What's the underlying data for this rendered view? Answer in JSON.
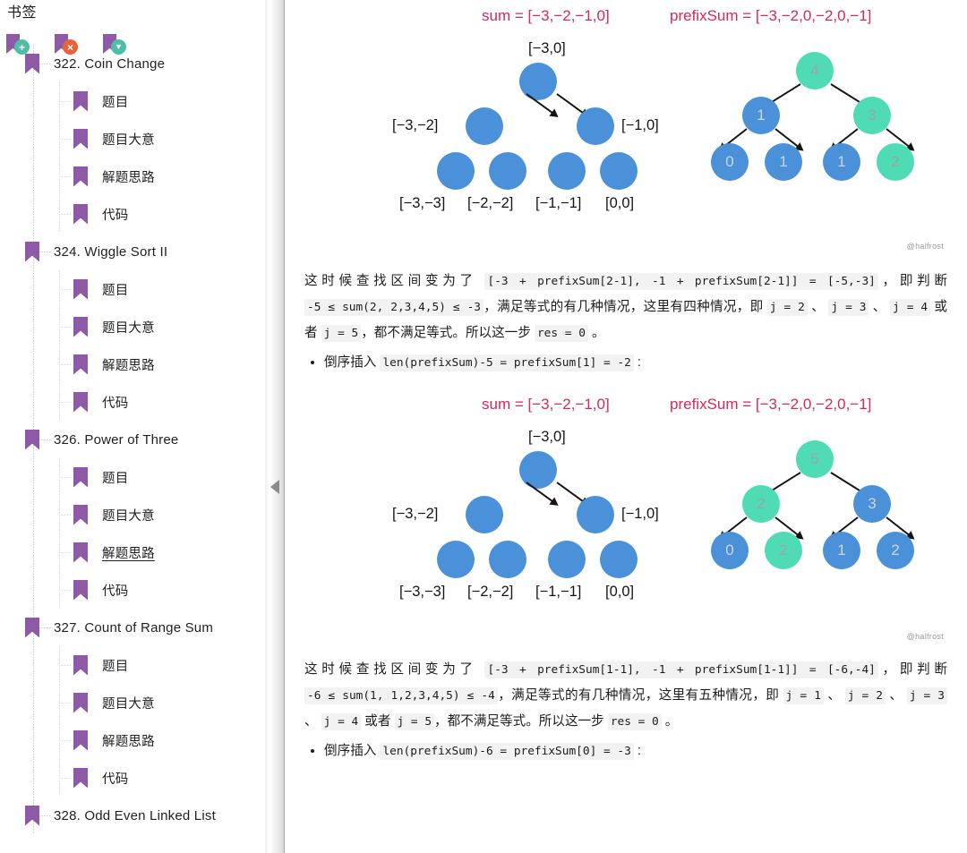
{
  "sidebar": {
    "title": "书签",
    "toolbar": [
      {
        "name": "add-bookmark-icon",
        "glyph": "+"
      },
      {
        "name": "delete-bookmark-icon",
        "glyph": "×"
      },
      {
        "name": "bookmark-menu-icon",
        "glyph": "▼"
      }
    ],
    "tree": [
      {
        "label": "322. Coin Change",
        "type": "group",
        "expanded": true
      },
      {
        "label": "题目",
        "type": "child"
      },
      {
        "label": "题目大意",
        "type": "child"
      },
      {
        "label": "解题思路",
        "type": "child"
      },
      {
        "label": "代码",
        "type": "child"
      },
      {
        "label": "324. Wiggle Sort II",
        "type": "group",
        "expanded": true
      },
      {
        "label": "题目",
        "type": "child"
      },
      {
        "label": "题目大意",
        "type": "child"
      },
      {
        "label": "解题思路",
        "type": "child"
      },
      {
        "label": "代码",
        "type": "child"
      },
      {
        "label": "326. Power of Three",
        "type": "group",
        "expanded": true
      },
      {
        "label": "题目",
        "type": "child"
      },
      {
        "label": "题目大意",
        "type": "child"
      },
      {
        "label": "解题思路",
        "type": "child",
        "active": true
      },
      {
        "label": "代码",
        "type": "child"
      },
      {
        "label": "327. Count of Range Sum",
        "type": "group",
        "expanded": true
      },
      {
        "label": "题目",
        "type": "child"
      },
      {
        "label": "题目大意",
        "type": "child"
      },
      {
        "label": "解题思路",
        "type": "child"
      },
      {
        "label": "代码",
        "type": "child"
      },
      {
        "label": "328. Odd Even Linked List",
        "type": "group",
        "expanded": true
      }
    ]
  },
  "splitter": {
    "collapse_icon": "collapse-left-arrow"
  },
  "colors": {
    "bookmark_purple": "#8e5aa8",
    "badge_add": "#4cbfa6",
    "badge_delete": "#e8633a",
    "title_red": "#d6285a",
    "node_blue": "#4a91da",
    "node_green": "#4fdcb4"
  },
  "content": {
    "figures": [
      {
        "watermark": "@halfrost",
        "left": {
          "title": "sum = [−3,−2,−1,0]",
          "root_label": "[−3,0]",
          "mid_labels": [
            "[−3,−2]",
            "[−1,0]"
          ],
          "leaf_labels": [
            "[−3,−3]",
            "[−2,−2]",
            "[−1,−1]",
            "[0,0]"
          ]
        },
        "right": {
          "title": "prefixSum = [−3,−2,0,−2,0,−1]",
          "nodes": {
            "root": {
              "value": "4",
              "color": "green"
            },
            "left": {
              "value": "1",
              "color": "blue"
            },
            "right": {
              "value": "3",
              "color": "green"
            },
            "leaves": [
              {
                "value": "0",
                "color": "blue"
              },
              {
                "value": "1",
                "color": "blue"
              },
              {
                "value": "1",
                "color": "blue"
              },
              {
                "value": "2",
                "color": "green"
              }
            ]
          }
        }
      },
      {
        "watermark": "@halfrost",
        "left": {
          "title": "sum = [−3,−2,−1,0]",
          "root_label": "[−3,0]",
          "mid_labels": [
            "[−3,−2]",
            "[−1,0]"
          ],
          "leaf_labels": [
            "[−3,−3]",
            "[−2,−2]",
            "[−1,−1]",
            "[0,0]"
          ]
        },
        "right": {
          "title": "prefixSum = [−3,−2,0,−2,0,−1]",
          "nodes": {
            "root": {
              "value": "5",
              "color": "green"
            },
            "left": {
              "value": "2",
              "color": "green"
            },
            "right": {
              "value": "3",
              "color": "blue"
            },
            "leaves": [
              {
                "value": "0",
                "color": "blue"
              },
              {
                "value": "2",
                "color": "green"
              },
              {
                "value": "1",
                "color": "blue"
              },
              {
                "value": "2",
                "color": "blue"
              }
            ]
          }
        }
      }
    ],
    "paragraph1": {
      "t1": "这时候查找区间变为了 ",
      "c1": "[-3 + prefixSum[2-1], -1 + prefixSum[2-1]] = [-5,-3]",
      "t2": "，即判断 ",
      "c2": "-5 ≤ sum(2,  2,3,4,5) ≤ -3",
      "t3": "，满足等式的有几种情况，这里有四种情况，即 ",
      "c3": "j = 2",
      "t4": " 、 ",
      "c4": "j = 3",
      "t5": " 、 ",
      "c5": "j = 4",
      "t6": " 或者 ",
      "c6": "j = 5",
      "t7": "，都不满足等式。所以这一步 ",
      "c7": "res = 0",
      "t8": " 。"
    },
    "bullet1": {
      "text": "倒序插入 ",
      "code": "len(prefixSum)-5 = prefixSum[1] = -2",
      "tail": " :"
    },
    "paragraph2": {
      "t1": "这时候查找区间变为了 ",
      "c1": "[-3 + prefixSum[1-1], -1 + prefixSum[1-1]] = [-6,-4]",
      "t2": "，即判断 ",
      "c2": "-6 ≤ sum(1,  1,2,3,4,5) ≤ -4",
      "t3": "，满足等式的有几种情况，这里有五种情况，即 ",
      "c3": "j = 1",
      "t4": " 、 ",
      "c4": "j = 2",
      "t5": " 、 ",
      "c5": "j = 3",
      "t6": " 、 ",
      "c6": "j = 4",
      "t7": " 或者 ",
      "c7": "j = 5",
      "t8": "，都不满足等式。所以这一步 ",
      "c8": "res = 0",
      "t9": " 。"
    },
    "bullet2": {
      "text": "倒序插入 ",
      "code": "len(prefixSum)-6 = prefixSum[0] = -3",
      "tail": " :"
    }
  }
}
